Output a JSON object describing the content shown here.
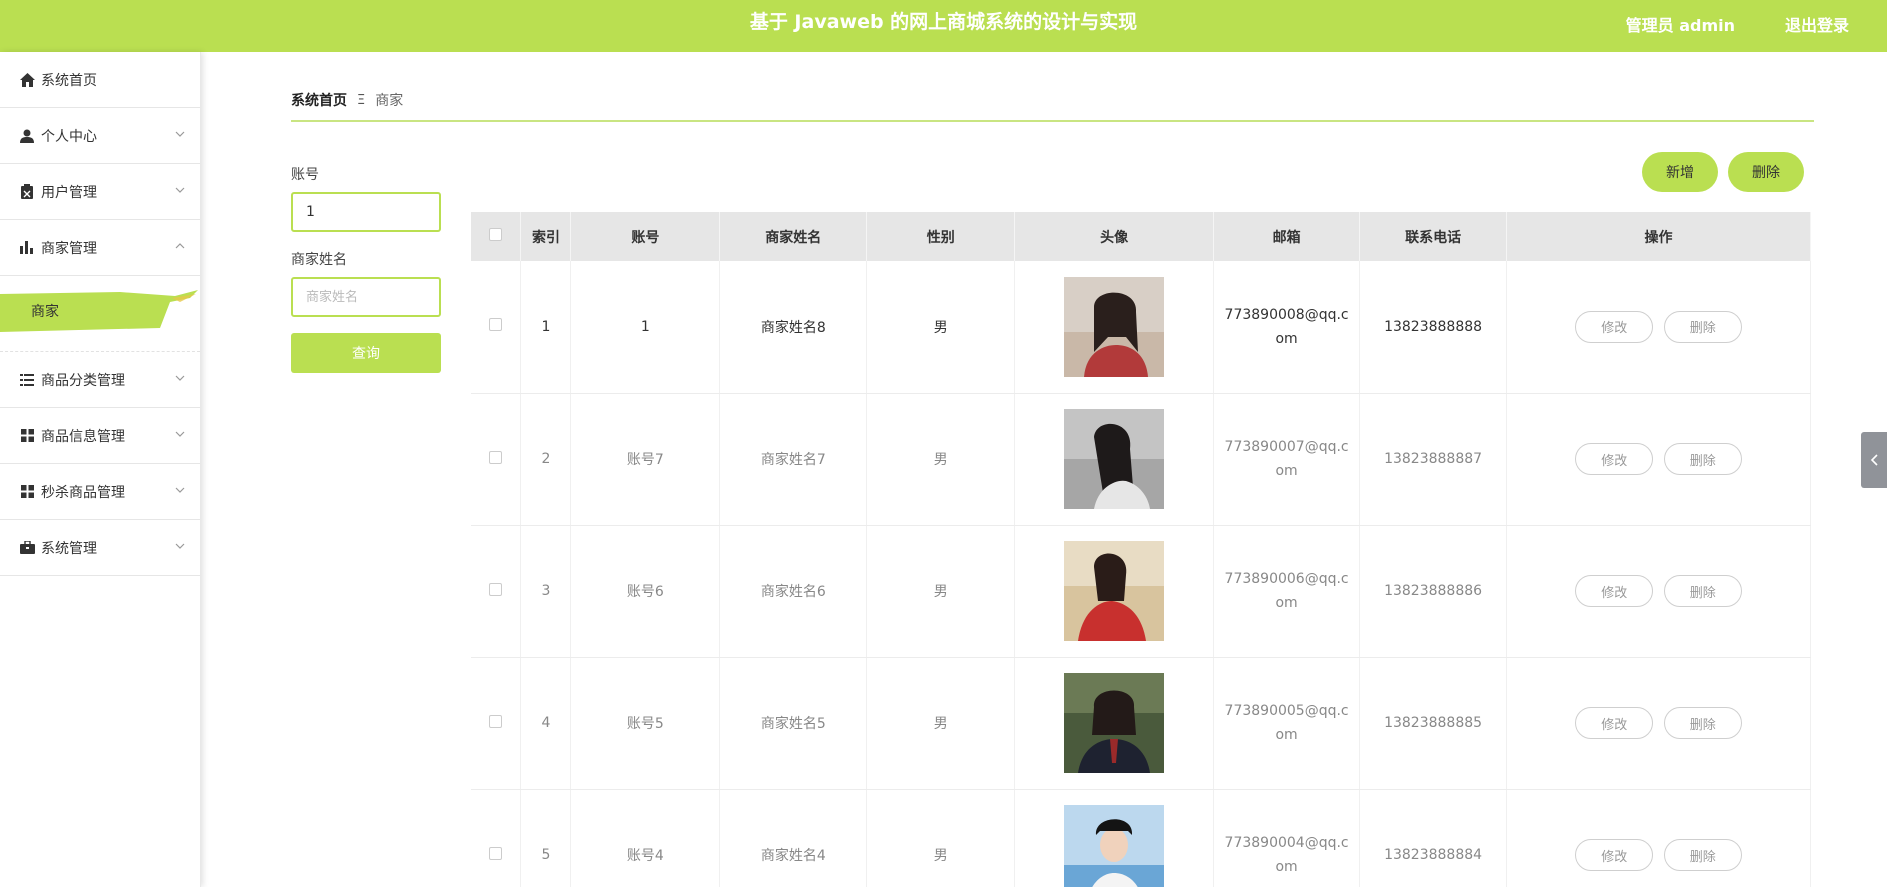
{
  "header": {
    "title": "基于 Javaweb 的网上商城系统的设计与实现",
    "user": "管理员 admin",
    "logout": "退出登录",
    "color": "#badf51"
  },
  "sidebar": {
    "items": [
      {
        "label": "系统首页",
        "icon": "home-icon"
      },
      {
        "label": "个人中心",
        "icon": "user-icon"
      },
      {
        "label": "用户管理",
        "icon": "clipboard-icon"
      },
      {
        "label": "商家管理",
        "icon": "bar-chart-icon"
      },
      {
        "label": "商品分类管理",
        "icon": "list-icon"
      },
      {
        "label": "商品信息管理",
        "icon": "grid-icon"
      },
      {
        "label": "秒杀商品管理",
        "icon": "grid-icon"
      },
      {
        "label": "系统管理",
        "icon": "briefcase-icon"
      }
    ],
    "submenu": {
      "label": "商家"
    }
  },
  "breadcrumb": {
    "home": "系统首页",
    "separator": "Ξ",
    "current": "商家"
  },
  "search": {
    "account_label": "账号",
    "account_value": "1",
    "name_label": "商家姓名",
    "name_placeholder": "商家姓名",
    "query_button": "查询"
  },
  "actions": {
    "add": "新增",
    "delete": "删除"
  },
  "table": {
    "headers": [
      "索引",
      "账号",
      "商家姓名",
      "性别",
      "头像",
      "邮箱",
      "联系电话",
      "操作"
    ],
    "edit_label": "修改",
    "delete_label": "删除",
    "rows": [
      {
        "index": "1",
        "account": "1",
        "name": "商家姓名8",
        "gender": "男",
        "email": "773890008@qq.com",
        "phone": "13823888888"
      },
      {
        "index": "2",
        "account": "账号7",
        "name": "商家姓名7",
        "gender": "男",
        "email": "773890007@qq.com",
        "phone": "13823888887"
      },
      {
        "index": "3",
        "account": "账号6",
        "name": "商家姓名6",
        "gender": "男",
        "email": "773890006@qq.com",
        "phone": "13823888886"
      },
      {
        "index": "4",
        "account": "账号5",
        "name": "商家姓名5",
        "gender": "男",
        "email": "773890005@qq.com",
        "phone": "13823888885"
      },
      {
        "index": "5",
        "account": "账号4",
        "name": "商家姓名4",
        "gender": "男",
        "email": "773890004@qq.com",
        "phone": "13823888884"
      }
    ]
  }
}
